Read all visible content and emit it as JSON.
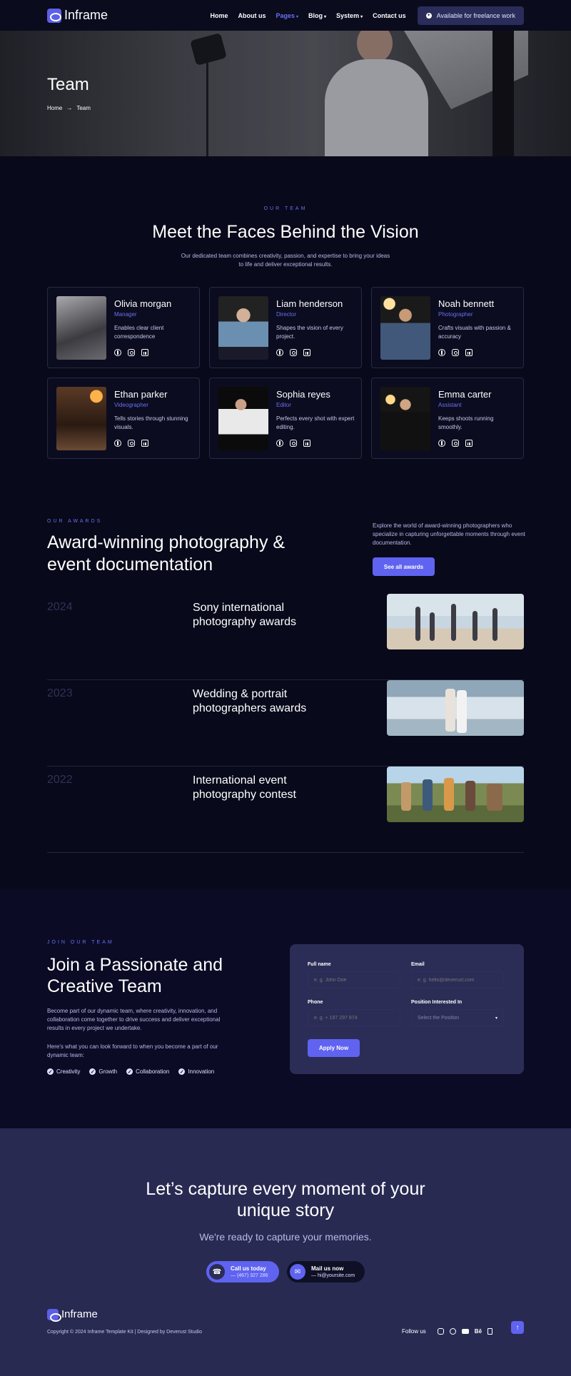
{
  "nav": {
    "logo_text": "Inframe",
    "menu": [
      {
        "label": "Home",
        "active": false,
        "caret": false
      },
      {
        "label": "About us",
        "active": false,
        "caret": false
      },
      {
        "label": "Pages",
        "active": true,
        "caret": true
      },
      {
        "label": "Blog",
        "active": false,
        "caret": true
      },
      {
        "label": "System",
        "active": false,
        "caret": true
      },
      {
        "label": "Contact us",
        "active": false,
        "caret": false
      }
    ],
    "cta_label": "Available for freelance work"
  },
  "hero": {
    "title": "Team",
    "breadcrumb_home": "Home",
    "breadcrumb_current": "Team"
  },
  "team": {
    "eyebrow": "OUR TEAM",
    "title": "Meet the Faces Behind the Vision",
    "subtitle": "Our dedicated team combines creativity, passion, and expertise to bring your ideas to life and deliver exceptional results.",
    "members": [
      {
        "name": "Olivia morgan",
        "role": "Manager",
        "desc": "Enables clear client correspondence"
      },
      {
        "name": "Liam henderson",
        "role": "Director",
        "desc": "Shapes the vision of every project."
      },
      {
        "name": "Noah bennett",
        "role": "Photographer",
        "desc": "Crafts visuals with passion & accuracy"
      },
      {
        "name": "Ethan parker",
        "role": "Videographer",
        "desc": "Tells stories through stunning visuals."
      },
      {
        "name": "Sophia reyes",
        "role": "Editor",
        "desc": "Perfects every shot with expert editing."
      },
      {
        "name": "Emma carter",
        "role": "Assistant",
        "desc": "Keeps shoots running smoothly."
      }
    ]
  },
  "awards": {
    "eyebrow": "OUR AWARDS",
    "title": "Award-winning photography & event documentation",
    "description": "Explore the world of award-winning photographers who specialize in capturing unforgettable moments through event documentation.",
    "button": "See all awards",
    "items": [
      {
        "year": "2024",
        "name": "Sony international photography awards"
      },
      {
        "year": "2023",
        "name": "Wedding & portrait photographers awards"
      },
      {
        "year": "2022",
        "name": "International event photography contest"
      }
    ]
  },
  "join": {
    "eyebrow": "JOIN OUR TEAM",
    "title": "Join a Passionate and Creative Team",
    "paragraph1": "Become part of our dynamic team, where creativity, innovation, and collaboration come together to drive success and deliver exceptional results in every project we undertake.",
    "paragraph2": "Here's what you can look forward to when you become a part of our dynamic team:",
    "perks": [
      "Creativity",
      "Growth",
      "Collaboration",
      "Innovation"
    ],
    "form": {
      "full_name_label": "Full name",
      "full_name_placeholder": "e. g. John Doe",
      "email_label": "Email",
      "email_placeholder": "e. g. hello@deverust.com",
      "phone_label": "Phone",
      "phone_placeholder": "e. g. + 197 297 874",
      "position_label": "Position Interested In",
      "position_selected": "Select the Position",
      "submit": "Apply Now"
    }
  },
  "cta": {
    "title": "Let’s capture every moment of your unique story",
    "subtitle": "We're ready to capture your memories.",
    "call_label": "Call us today",
    "call_value": "— (467) 327 286",
    "mail_label": "Mail us now",
    "mail_value": "— hi@yoursite.com"
  },
  "footer": {
    "logo_text": "Inframe",
    "copyright": "Copyright © 2024 Inframe Template Kit | Designed by Deverust Studio",
    "follow_label": "Follow us",
    "social_icons": [
      "instagram-icon",
      "facebook-icon",
      "youtube-icon",
      "behance-icon",
      "document-icon"
    ]
  },
  "colors": {
    "accent": "#5f63f0",
    "background": "#08091a",
    "panel": "#2c2d56"
  }
}
